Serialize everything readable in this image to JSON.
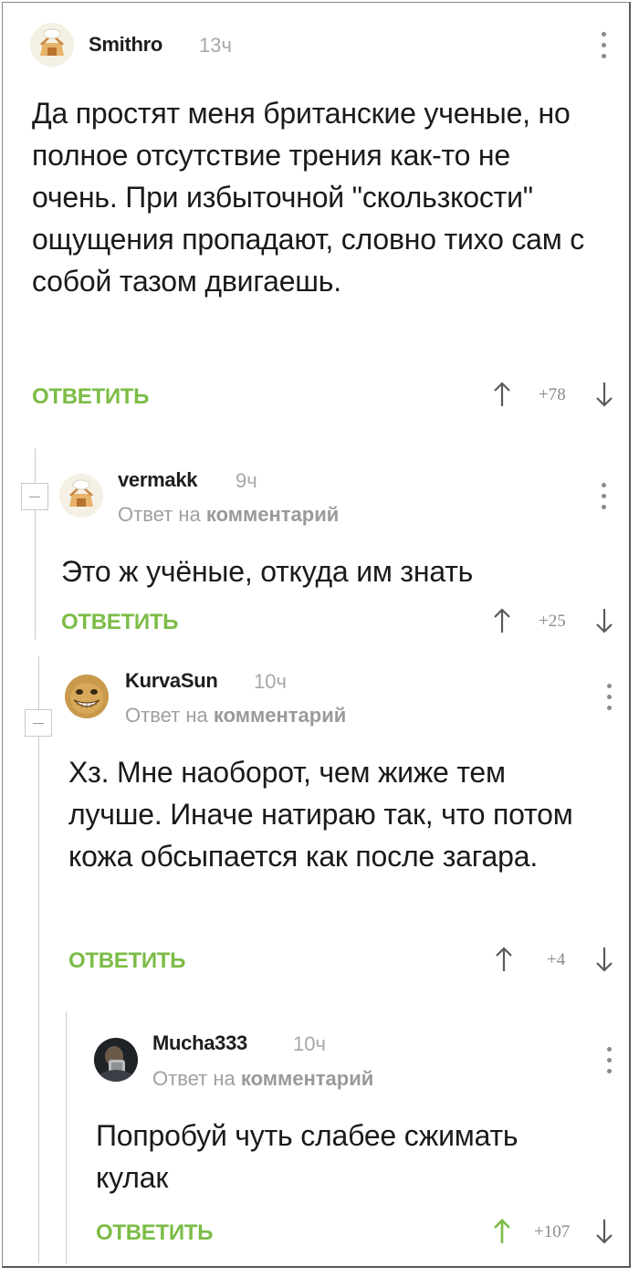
{
  "comments": [
    {
      "author": "Smithro",
      "time": "13ч",
      "text": "Да простят меня британские ученые, но полное отсутствие трения как-то не очень. При избыточной \"скользкости\" ощущения пропадают, словно тихо сам с собой тазом двигаешь.",
      "reply_label": "ОТВЕТИТЬ",
      "score": "+78",
      "avatar": "default-avatar-icon"
    },
    {
      "author": "vermakk",
      "time": "9ч",
      "reply_prefix": "Ответ на",
      "reply_target": "комментарий",
      "text": "Это ж учёные, откуда им знать",
      "reply_label": "ОТВЕТИТЬ",
      "score": "+25",
      "avatar": "default-avatar-icon"
    },
    {
      "author": "KurvaSun",
      "time": "10ч",
      "reply_prefix": "Ответ на",
      "reply_target": "комментарий",
      "text": "Хз. Мне наоборот, чем жиже тем лучше. Иначе натираю так, что потом кожа обсыпается как после загара.",
      "reply_label": "ОТВЕТИТЬ",
      "score": "+4",
      "avatar": "grinning-face-avatar"
    },
    {
      "author": "Mucha333",
      "time": "10ч",
      "reply_prefix": "Ответ на",
      "reply_target": "комментарий",
      "text": "Попробуй чуть слабее сжимать кулак",
      "reply_label": "ОТВЕТИТЬ",
      "score": "+107",
      "avatar": "photo-avatar",
      "upvoted": true
    }
  ],
  "colors": {
    "accent_green": "#7cbc47",
    "muted_gray": "#a8a8a8",
    "text": "#1a1a1a",
    "thread_line": "#c9c9c9"
  }
}
